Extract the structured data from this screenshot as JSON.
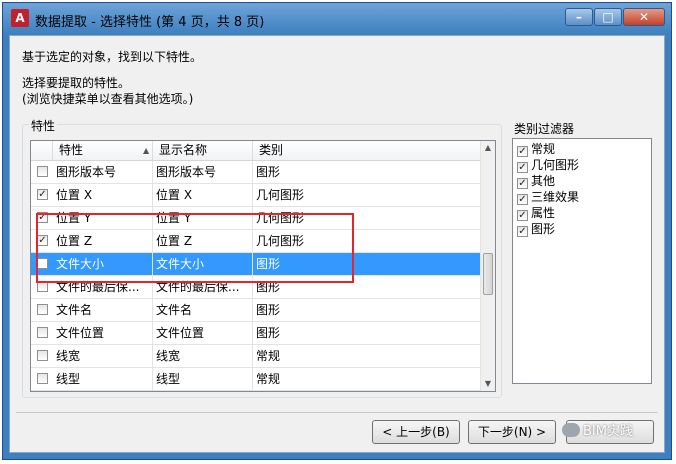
{
  "window": {
    "title": "数据提取 - 选择特性 (第 4 页，共 8 页)",
    "app_icon": "A",
    "buttons": {
      "minimize": "–",
      "maximize": "□",
      "close": "✕"
    }
  },
  "instructions": {
    "line1": "基于选定的对象，找到以下特性。",
    "line2": "选择要提取的特性。",
    "line3": "(浏览快捷菜单以查看其他选项。)"
  },
  "properties_group": {
    "label": "特性",
    "columns": {
      "property": "特性",
      "display_name": "显示名称",
      "category": "类别"
    },
    "rows": [
      {
        "checked": false,
        "property": "图形版本号",
        "display_name": "图形版本号",
        "category": "图形",
        "selected": false
      },
      {
        "checked": true,
        "property": "位置 X",
        "display_name": "位置 X",
        "category": "几何图形",
        "selected": false
      },
      {
        "checked": true,
        "property": "位置 Y",
        "display_name": "位置 Y",
        "category": "几何图形",
        "selected": false
      },
      {
        "checked": true,
        "property": "位置 Z",
        "display_name": "位置 Z",
        "category": "几何图形",
        "selected": false
      },
      {
        "checked": false,
        "property": "文件大小",
        "display_name": "文件大小",
        "category": "图形",
        "selected": true
      },
      {
        "checked": false,
        "property": "文件的最后保...",
        "display_name": "文件的最后保...",
        "category": "图形",
        "selected": false
      },
      {
        "checked": false,
        "property": "文件名",
        "display_name": "文件名",
        "category": "图形",
        "selected": false
      },
      {
        "checked": false,
        "property": "文件位置",
        "display_name": "文件位置",
        "category": "图形",
        "selected": false
      },
      {
        "checked": false,
        "property": "线宽",
        "display_name": "线宽",
        "category": "常规",
        "selected": false
      },
      {
        "checked": false,
        "property": "线型",
        "display_name": "线型",
        "category": "常规",
        "selected": false
      }
    ]
  },
  "category_filter": {
    "label": "类别过滤器",
    "items": [
      {
        "label": "常规",
        "checked": true
      },
      {
        "label": "几何图形",
        "checked": true
      },
      {
        "label": "其他",
        "checked": true
      },
      {
        "label": "三维效果",
        "checked": true
      },
      {
        "label": "属性",
        "checked": true
      },
      {
        "label": "图形",
        "checked": true
      }
    ]
  },
  "buttons": {
    "back": "< 上一步(B)",
    "next": "下一步(N) >"
  },
  "watermark": "BIM实践",
  "colors": {
    "selection": "#3399ff",
    "highlight_box": "#e3262b",
    "titlebar": "#3d7fc0"
  }
}
